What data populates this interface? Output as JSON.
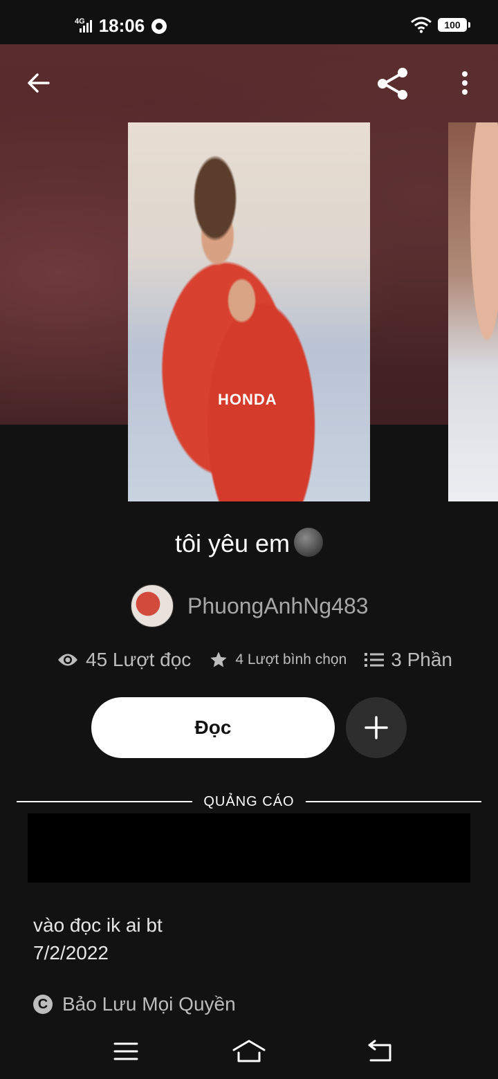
{
  "status_bar": {
    "network": "4G",
    "time": "18:06",
    "battery": "100",
    "icons": [
      "signal-icon",
      "vpn-icon",
      "wifi-icon",
      "battery-icon"
    ]
  },
  "toolbar": {
    "icons": [
      "back-arrow-icon",
      "share-icon",
      "more-vertical-icon"
    ]
  },
  "cover": {
    "brand_text": "HONDA"
  },
  "story": {
    "title": "tôi yêu em",
    "author": "PhuongAnhNg483",
    "stats": {
      "reads": "45 Lượt đọc",
      "votes": "4 Lượt bình chọn",
      "parts": "3 Phần"
    },
    "read_button": "Đọc",
    "ad_label": "QUẢNG CÁO",
    "description_line1": "vào đọc ik ai bt",
    "description_line2": "7/2/2022",
    "rights": "Bảo Lưu Mọi Quyền"
  },
  "nav": {
    "icons": [
      "menu-icon",
      "home-icon",
      "back-icon"
    ]
  },
  "colors": {
    "background": "#121212",
    "hero": "#4c2527",
    "button_bg": "#ffffff",
    "muted_text": "#a7a7a7"
  }
}
